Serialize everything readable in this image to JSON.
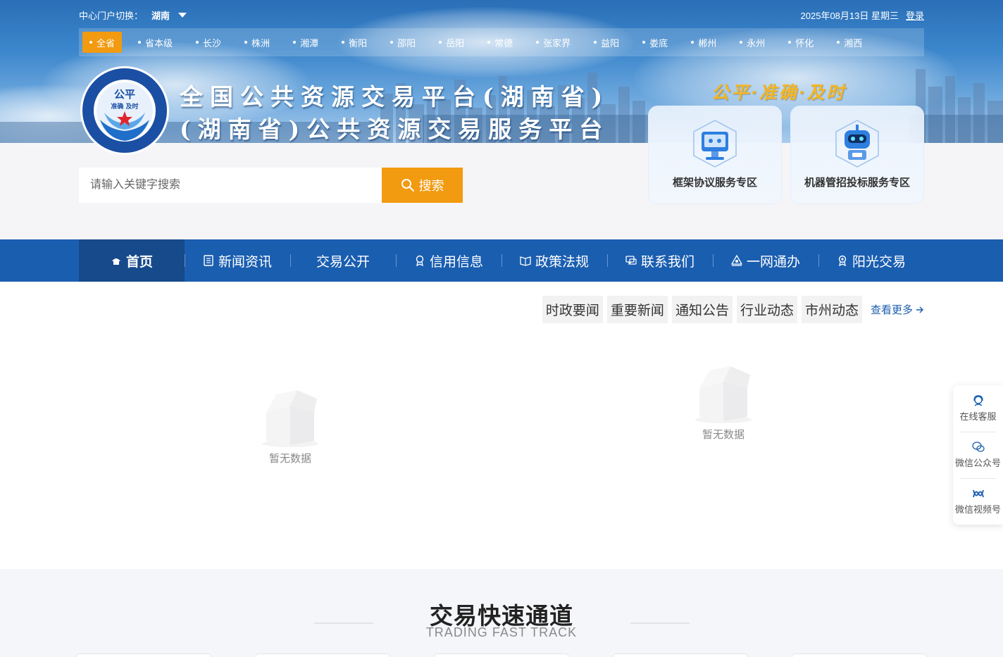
{
  "topbar": {
    "portal_label": "中心门户切换：",
    "portal_value": "湖南",
    "date": "2025年08月13日 星期三",
    "login": "登录"
  },
  "cities": [
    "全省",
    "省本级",
    "长沙",
    "株洲",
    "湘潭",
    "衡阳",
    "邵阳",
    "岳阳",
    "常德",
    "张家界",
    "益阳",
    "娄底",
    "郴州",
    "永州",
    "怀化",
    "湘西"
  ],
  "header": {
    "title_line1": "全国公共资源交易平台(湖南省)",
    "title_line2": "(湖南省)公共资源交易服务平台",
    "slogan": "公平·准确·及时",
    "logo_center": "公平",
    "logo_sub": "准确 及时"
  },
  "zones": [
    {
      "label": "框架协议服务专区",
      "icon": "robot-screen-icon"
    },
    {
      "label": "机器管招投标服务专区",
      "icon": "robot-head-icon"
    }
  ],
  "search": {
    "placeholder": "请输入关键字搜索",
    "button": "搜索"
  },
  "nav": [
    {
      "label": "首页",
      "icon": "home-icon"
    },
    {
      "label": "新闻资讯",
      "icon": "news-icon"
    },
    {
      "label": "交易公开",
      "icon": ""
    },
    {
      "label": "信用信息",
      "icon": "badge-icon"
    },
    {
      "label": "政策法规",
      "icon": "book-icon"
    },
    {
      "label": "联系我们",
      "icon": "chat-icon"
    },
    {
      "label": "一网通办",
      "icon": "network-icon"
    },
    {
      "label": "阳光交易",
      "icon": "medal-icon"
    }
  ],
  "news": {
    "tabs": [
      "时政要闻",
      "重要新闻",
      "通知公告",
      "行业动态",
      "市州动态"
    ],
    "more": "查看更多",
    "empty_text": "暂无数据"
  },
  "floatbar": [
    {
      "label": "在线客服",
      "icon": "headset-icon"
    },
    {
      "label": "微信公众号",
      "icon": "wechat-icon"
    },
    {
      "label": "微信视频号",
      "icon": "video-channel-icon"
    }
  ],
  "fasttrack": {
    "title": "交易快速通道",
    "subtitle": "TRADING FAST TRACK"
  },
  "colors": {
    "primary": "#1a5eb0",
    "accent": "#f29a10",
    "slogan": "#f5b621"
  }
}
